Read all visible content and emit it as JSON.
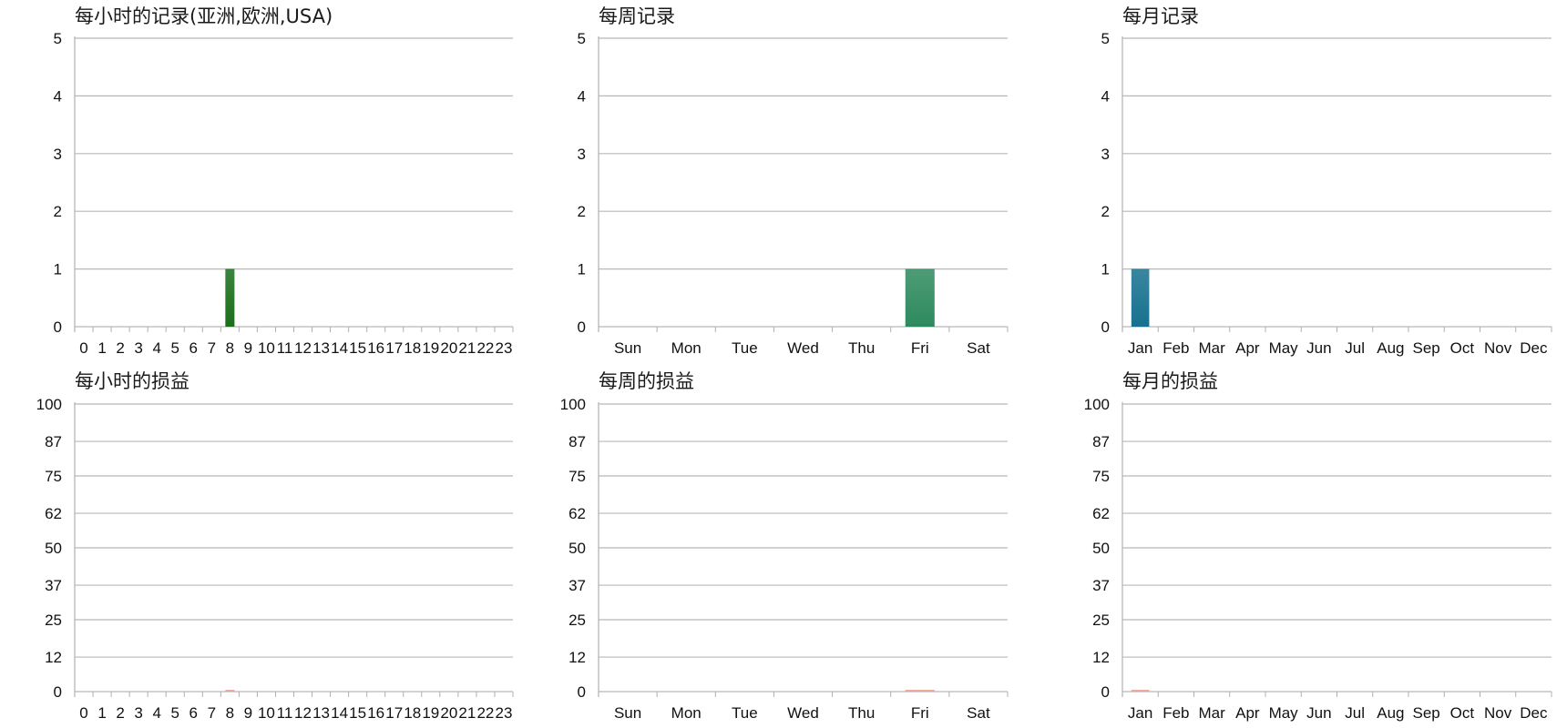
{
  "chart_data": [
    {
      "type": "bar",
      "title": "每小时的记录(亚洲,欧洲,USA)",
      "categories": [
        "0",
        "1",
        "2",
        "3",
        "4",
        "5",
        "6",
        "7",
        "8",
        "9",
        "10",
        "11",
        "12",
        "13",
        "14",
        "15",
        "16",
        "17",
        "18",
        "19",
        "20",
        "21",
        "22",
        "23"
      ],
      "series": [
        {
          "values": [
            0,
            0,
            0,
            0,
            0,
            0,
            0,
            0,
            1,
            0,
            0,
            0,
            0,
            0,
            0,
            0,
            0,
            0,
            0,
            0,
            0,
            0,
            0,
            0
          ]
        }
      ],
      "ylim": [
        0,
        5
      ],
      "yticks": [
        "0",
        "1",
        "2",
        "3",
        "4",
        "5"
      ],
      "grid": true,
      "color": "#1b6e1b"
    },
    {
      "type": "bar",
      "title": "每周记录",
      "categories": [
        "Sun",
        "Mon",
        "Tue",
        "Wed",
        "Thu",
        "Fri",
        "Sat"
      ],
      "series": [
        {
          "values": [
            0,
            0,
            0,
            0,
            0,
            1,
            0
          ]
        }
      ],
      "ylim": [
        0,
        5
      ],
      "yticks": [
        "0",
        "1",
        "2",
        "3",
        "4",
        "5"
      ],
      "grid": true,
      "color": "#2e8a5e"
    },
    {
      "type": "bar",
      "title": "每月记录",
      "categories": [
        "Jan",
        "Feb",
        "Mar",
        "Apr",
        "May",
        "Jun",
        "Jul",
        "Aug",
        "Sep",
        "Oct",
        "Nov",
        "Dec"
      ],
      "series": [
        {
          "values": [
            1,
            0,
            0,
            0,
            0,
            0,
            0,
            0,
            0,
            0,
            0,
            0
          ]
        }
      ],
      "ylim": [
        0,
        5
      ],
      "yticks": [
        "0",
        "1",
        "2",
        "3",
        "4",
        "5"
      ],
      "grid": true,
      "color": "#17718f"
    },
    {
      "type": "bar",
      "title": "每小时的损益",
      "categories": [
        "0",
        "1",
        "2",
        "3",
        "4",
        "5",
        "6",
        "7",
        "8",
        "9",
        "10",
        "11",
        "12",
        "13",
        "14",
        "15",
        "16",
        "17",
        "18",
        "19",
        "20",
        "21",
        "22",
        "23"
      ],
      "series": [
        {
          "values": [
            0,
            0,
            0,
            0,
            0,
            0,
            0,
            0,
            0.15,
            0,
            0,
            0,
            0,
            0,
            0,
            0,
            0,
            0,
            0,
            0,
            0,
            0,
            0,
            0
          ]
        }
      ],
      "ylim": [
        0,
        100
      ],
      "yticks": [
        "0",
        "12",
        "25",
        "37",
        "50",
        "62",
        "75",
        "87",
        "100"
      ],
      "grid": true,
      "color": "#f0a090"
    },
    {
      "type": "bar",
      "title": "每周的损益",
      "categories": [
        "Sun",
        "Mon",
        "Tue",
        "Wed",
        "Thu",
        "Fri",
        "Sat"
      ],
      "series": [
        {
          "values": [
            0,
            0,
            0,
            0,
            0,
            0.15,
            0
          ]
        }
      ],
      "ylim": [
        0,
        100
      ],
      "yticks": [
        "0",
        "12",
        "25",
        "37",
        "50",
        "62",
        "75",
        "87",
        "100"
      ],
      "grid": true,
      "color": "#f0a090"
    },
    {
      "type": "bar",
      "title": "每月的损益",
      "categories": [
        "Jan",
        "Feb",
        "Mar",
        "Apr",
        "May",
        "Jun",
        "Jul",
        "Aug",
        "Sep",
        "Oct",
        "Nov",
        "Dec"
      ],
      "series": [
        {
          "values": [
            0.15,
            0,
            0,
            0,
            0,
            0,
            0,
            0,
            0,
            0,
            0,
            0
          ]
        }
      ],
      "ylim": [
        0,
        100
      ],
      "yticks": [
        "0",
        "12",
        "25",
        "37",
        "50",
        "62",
        "75",
        "87",
        "100"
      ],
      "grid": true,
      "color": "#f0a090"
    }
  ]
}
